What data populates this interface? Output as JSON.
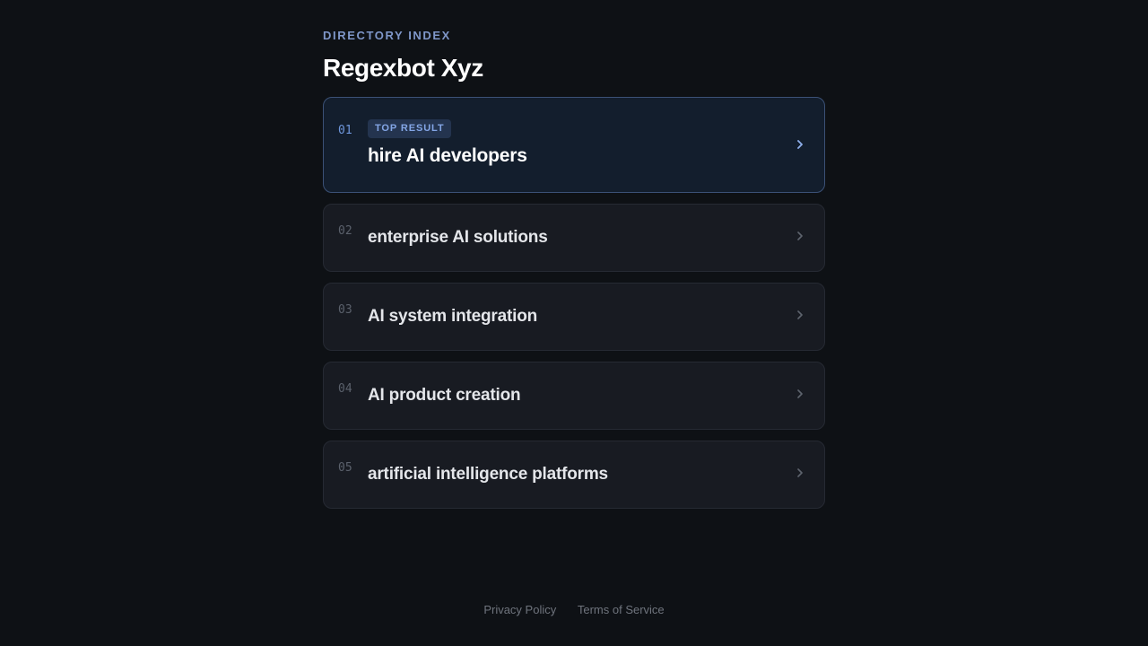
{
  "header": {
    "eyebrow": "DIRECTORY INDEX",
    "title": "Regexbot Xyz"
  },
  "results": [
    {
      "number": "01",
      "badge": "TOP RESULT",
      "label": "hire AI developers",
      "top": true
    },
    {
      "number": "02",
      "label": "enterprise AI solutions"
    },
    {
      "number": "03",
      "label": "AI system integration"
    },
    {
      "number": "04",
      "label": "AI product creation"
    },
    {
      "number": "05",
      "label": "artificial intelligence platforms"
    }
  ],
  "footer": {
    "privacy": "Privacy Policy",
    "terms": "Terms of Service"
  },
  "colors": {
    "background": "#0e1115",
    "accent": "#7f97c9",
    "top_card_border": "#3b5176"
  },
  "icons": {
    "result_arrow": "chevron-right-icon"
  }
}
